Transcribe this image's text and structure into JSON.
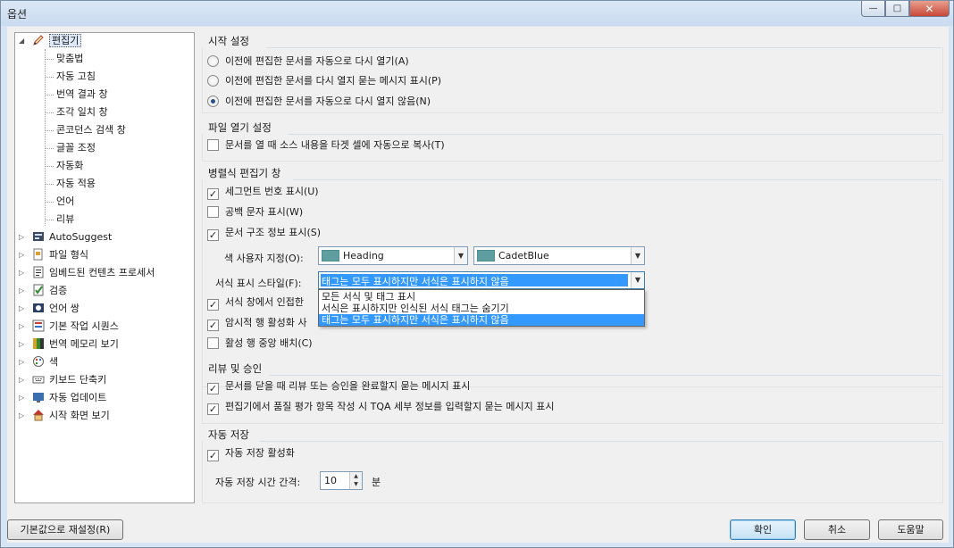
{
  "window": {
    "title": "옵션",
    "controls": {
      "minimize": "—",
      "maximize": "□",
      "close": "✕"
    }
  },
  "tree": {
    "root": {
      "label": "편집기",
      "icon": "pencil-icon",
      "expander": "◢"
    },
    "children": [
      "맞춤법",
      "자동 고침",
      "번역 결과 창",
      "조각 일치 창",
      "콘코던스 검색 창",
      "글꼴 조정",
      "자동화",
      "자동 적용",
      "언어",
      "리뷰"
    ],
    "nodes": [
      {
        "label": "AutoSuggest",
        "icon": "autosuggest-icon"
      },
      {
        "label": "파일 형식",
        "icon": "file-types-icon"
      },
      {
        "label": "임베드된 컨텐츠 프로세서",
        "icon": "embedded-content-icon"
      },
      {
        "label": "검증",
        "icon": "verification-icon"
      },
      {
        "label": "언어 쌍",
        "icon": "language-pair-icon"
      },
      {
        "label": "기본 작업 시퀀스",
        "icon": "task-sequence-icon"
      },
      {
        "label": "번역 메모리 보기",
        "icon": "translation-memory-icon"
      },
      {
        "label": "색",
        "icon": "palette-icon"
      },
      {
        "label": "키보드 단축키",
        "icon": "keyboard-icon"
      },
      {
        "label": "자동 업데이트",
        "icon": "update-icon"
      },
      {
        "label": "시작 화면 보기",
        "icon": "home-icon"
      }
    ],
    "collapsed_glyph": "▷"
  },
  "startup": {
    "title": "시작 설정",
    "options": [
      {
        "label": "이전에 편집한 문서를 자동으로 다시 열기(A)",
        "selected": false
      },
      {
        "label": "이전에 편집한 문서를 다시 열지 묻는 메시지 표시(P)",
        "selected": false
      },
      {
        "label": "이전에 편집한 문서를 자동으로 다시 열지 않음(N)",
        "selected": true
      }
    ]
  },
  "file_open": {
    "title": "파일 열기 설정",
    "copy_source": {
      "label": "문서를 열 때 소스 내용을 타겟 셀에 자동으로 복사(T)",
      "checked": false
    }
  },
  "parallel_editor": {
    "title": "병렬식 편집기 창",
    "segment_numbers": {
      "label": "세그먼트 번호 표시(U)",
      "checked": true
    },
    "whitespace": {
      "label": "공백 문자 표시(W)",
      "checked": false
    },
    "doc_structure": {
      "label": "문서 구조 정보 표시(S)",
      "checked": true
    },
    "color_label": "색 사용자 지정(O):",
    "color_combo_1": {
      "value": "Heading",
      "swatch": "#5f9ea0"
    },
    "color_combo_2": {
      "value": "CadetBlue",
      "swatch": "#5f9ea0"
    },
    "format_style_label": "서식 표시 스타일(F):",
    "format_style_value": "태그는 모두 표시하지만 서식은 표시하지 않음",
    "format_style_options": [
      "모든 서식 및 태그 표시",
      "서식은 표시하지만 인식된 서식 태그는 숨기기",
      "태그는 모두 표시하지만 서식은 표시하지 않음"
    ],
    "format_style_highlighted": 2,
    "adjacent": {
      "label": "서식 창에서 인접한",
      "checked": true
    },
    "implicit_row": {
      "label": "암시적 행 활성화 사",
      "checked": true
    },
    "center_active": {
      "label": "활성 행 중앙 배치(C)",
      "checked": false
    }
  },
  "review": {
    "title": "리뷰 및 승인",
    "prompt_on_close": {
      "label": "문서를 닫을 때 리뷰 또는 승인을 완료할지 묻는 메시지 표시",
      "checked": true
    },
    "prompt_tqa": {
      "label": "편집기에서 품질 평가 항목 작성 시 TQA 세부 정보를 입력할지 묻는 메시지 표시",
      "checked": true
    }
  },
  "autosave": {
    "title": "자동 저장",
    "enable": {
      "label": "자동 저장 활성화",
      "checked": true
    },
    "interval_label": "자동 저장 시간 간격:",
    "interval_value": "10",
    "interval_unit": "분"
  },
  "buttons": {
    "reset": "기본값으로 재설정(R)",
    "ok": "확인",
    "cancel": "취소",
    "help": "도움말"
  },
  "glyphs": {
    "check": "✓",
    "combo_arrow": "▼",
    "spin_up": "▲",
    "spin_down": "▼"
  },
  "colors": {
    "accent": "#3399ff",
    "swatch": "#5f9ea0"
  }
}
